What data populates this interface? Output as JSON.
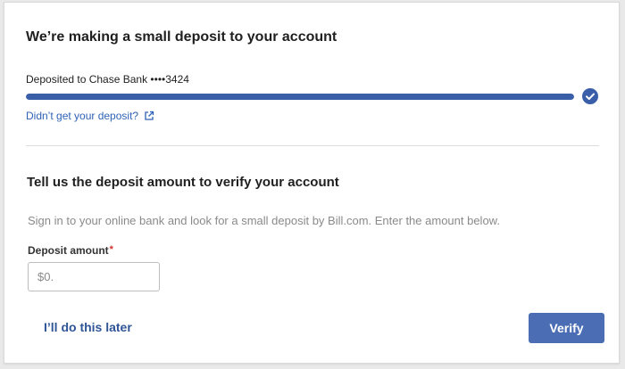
{
  "deposit": {
    "title": "We’re making a small deposit to your account",
    "deposited_label": "Deposited to Chase Bank ••••3424",
    "progress_percent": 100,
    "help_link_label": "Didn’t get your deposit?"
  },
  "verify": {
    "section_title": "Tell us the deposit amount to verify your account",
    "instructions": "Sign in to your online bank and look for a small deposit by Bill.com. Enter the amount below.",
    "amount_label": "Deposit amount",
    "required_marker": "*",
    "amount_placeholder": "$0.",
    "amount_value": ""
  },
  "actions": {
    "later_label": "I’ll do this later",
    "verify_label": "Verify"
  },
  "icons": {
    "status": "check-circle-icon",
    "external": "external-link-icon"
  },
  "colors": {
    "accent": "#3a5ea8",
    "link": "#2f62b6",
    "required": "#d0342c",
    "button": "#4a6db3"
  }
}
